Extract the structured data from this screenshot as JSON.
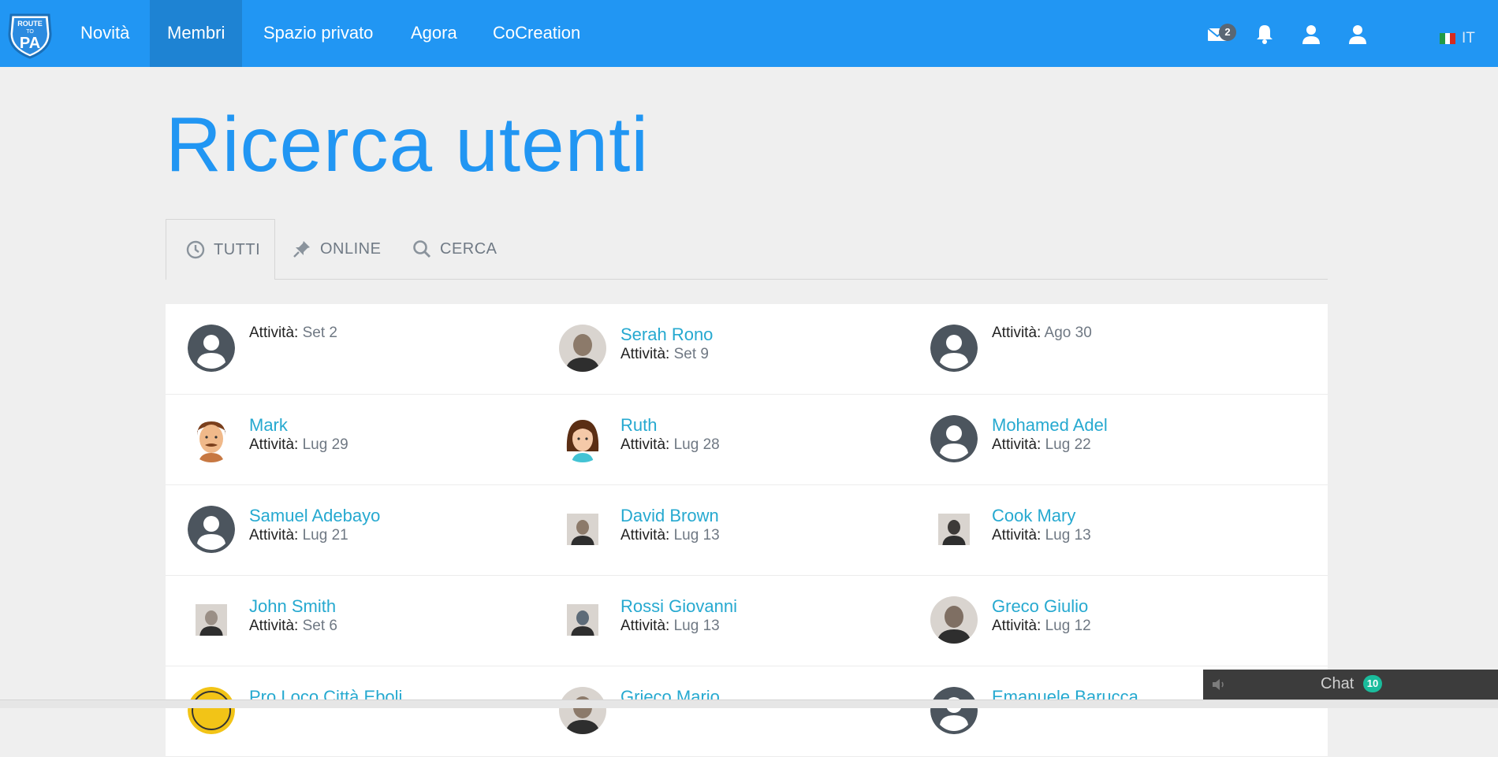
{
  "brand": {
    "logo_lines": [
      "ROUTE",
      "TO",
      "PA"
    ],
    "color": "#2196f3"
  },
  "nav": {
    "items": [
      {
        "label": "Novità"
      },
      {
        "label": "Membri",
        "active": true
      },
      {
        "label": "Spazio privato"
      },
      {
        "label": "Agora"
      },
      {
        "label": "CoCreation"
      }
    ],
    "icons": [
      "mail-icon",
      "bell-icon",
      "user-icon",
      "user-icon"
    ],
    "mail_badge": "2",
    "language": "IT"
  },
  "page": {
    "title": "Ricerca utenti"
  },
  "tabs": [
    {
      "label": "TUTTI",
      "icon": "clock-icon",
      "active": true
    },
    {
      "label": "ONLINE",
      "icon": "pin-icon"
    },
    {
      "label": "CERCA",
      "icon": "search-icon"
    }
  ],
  "activity_label": "Attività:",
  "members": [
    {
      "name": "",
      "date": "Set 2",
      "avatar": "default-avatar"
    },
    {
      "name": "Serah Rono",
      "date": "Set 9",
      "avatar": "photo-avatar"
    },
    {
      "name": "",
      "date": "Ago 30",
      "avatar": "default-avatar"
    },
    {
      "name": "Mark",
      "date": "Lug 29",
      "avatar": "cartoon-male-avatar"
    },
    {
      "name": "Ruth",
      "date": "Lug 28",
      "avatar": "cartoon-female-avatar"
    },
    {
      "name": "Mohamed Adel",
      "date": "Lug 22",
      "avatar": "default-avatar"
    },
    {
      "name": "Samuel Adebayo",
      "date": "Lug 21",
      "avatar": "default-avatar"
    },
    {
      "name": "David Brown",
      "date": "Lug 13",
      "avatar": "photo-avatar"
    },
    {
      "name": "Cook Mary",
      "date": "Lug 13",
      "avatar": "photo-avatar"
    },
    {
      "name": "John Smith",
      "date": "Set 6",
      "avatar": "photo-avatar"
    },
    {
      "name": "Rossi Giovanni",
      "date": "Lug 13",
      "avatar": "photo-avatar"
    },
    {
      "name": "Greco Giulio",
      "date": "Lug 12",
      "avatar": "photo-avatar"
    },
    {
      "name": "Pro Loco Città Eboli",
      "date": "",
      "avatar": "logo-avatar"
    },
    {
      "name": "Grieco Mario",
      "date": "",
      "avatar": "photo-avatar"
    },
    {
      "name": "Emanuele Barucca",
      "date": "",
      "avatar": "default-avatar"
    }
  ],
  "chat": {
    "label": "Chat",
    "count": "10",
    "icon": "speaker-icon"
  }
}
